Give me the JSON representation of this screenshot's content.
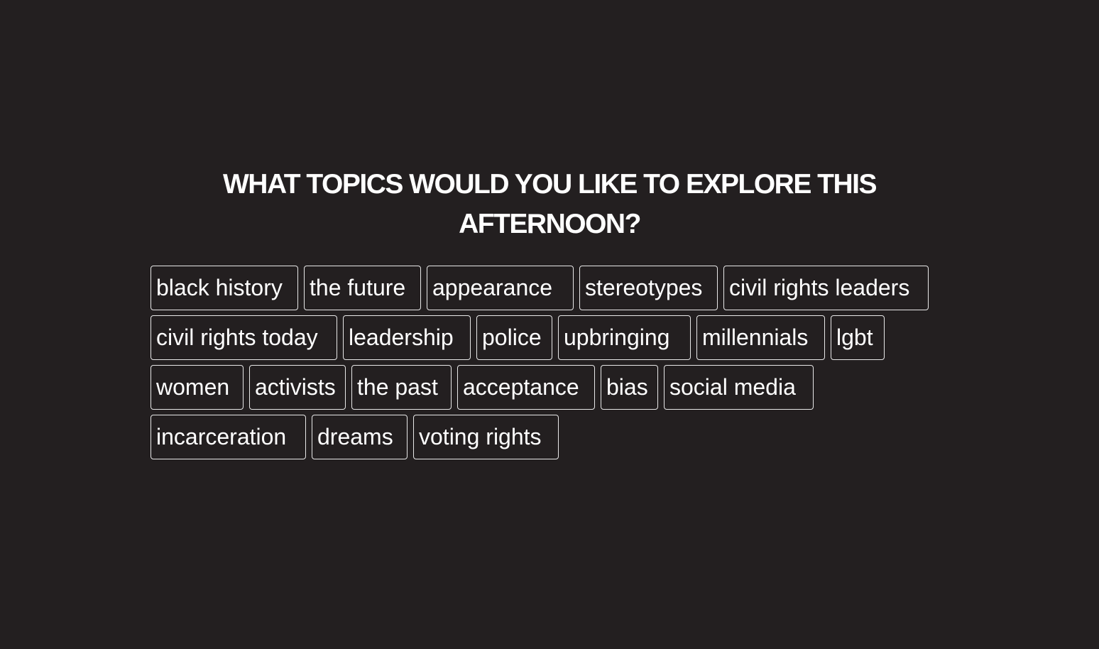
{
  "prompt": {
    "line1": "WHAT TOPICS WOULD YOU LIKE TO EXPLORE THIS",
    "line2": "AFTERNOON?"
  },
  "topics": {
    "row1": [
      "black history",
      "the future",
      "appearance",
      "stereotypes",
      "civil rights leaders"
    ],
    "row2": [
      "civil rights today",
      "leadership",
      "police",
      "upbringing",
      "millennials",
      "lgbt"
    ],
    "row3": [
      "women",
      "activists",
      "the past",
      "acceptance",
      "bias",
      "social media"
    ],
    "row4": [
      "incarceration",
      "dreams",
      "voting rights"
    ]
  },
  "colors": {
    "background": "#231f20",
    "text": "#ffffff",
    "border": "#e8e8e8"
  }
}
